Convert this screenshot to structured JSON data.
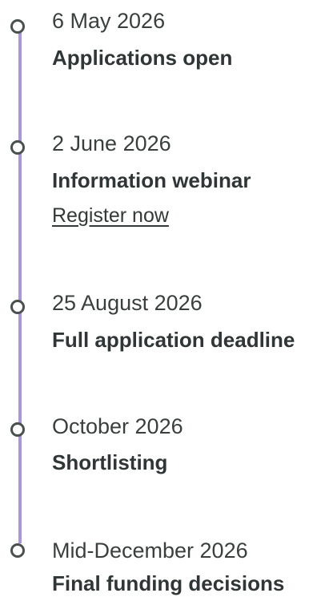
{
  "timeline": {
    "events": [
      {
        "date": "6 May 2026",
        "title": "Applications open"
      },
      {
        "date": "2 June 2026",
        "title": "Information webinar",
        "link": "Register now"
      },
      {
        "date": "25 August 2026",
        "title": "Full application deadline"
      },
      {
        "date": "October 2026",
        "title": "Shortlisting"
      },
      {
        "date": "Mid-December 2026",
        "title": "Final funding decisions"
      }
    ]
  },
  "colors": {
    "line": "#a996dd",
    "marker": "#4a504e",
    "text": "#2b3230"
  }
}
